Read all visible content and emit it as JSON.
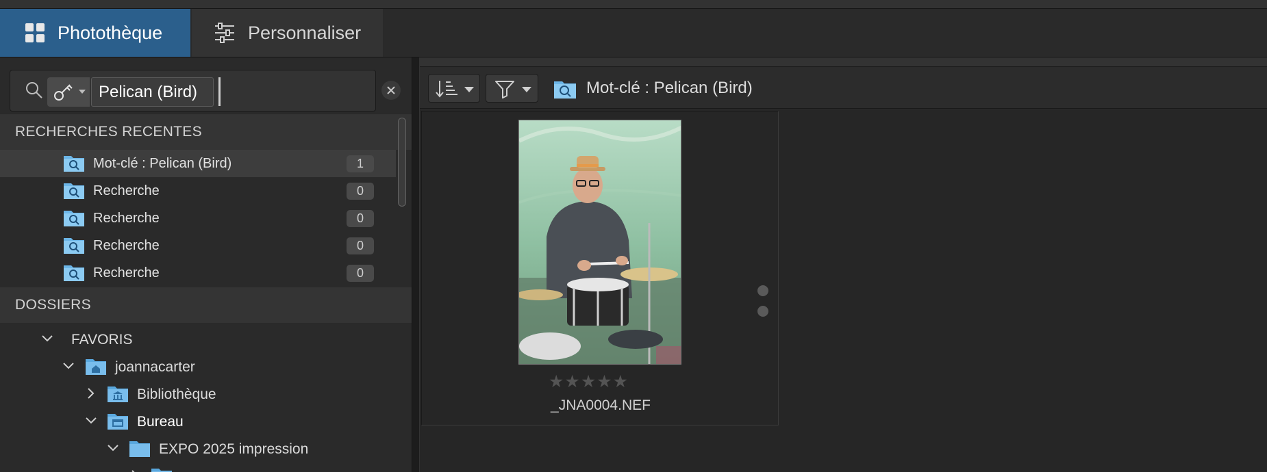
{
  "tabs": {
    "library": "Photothèque",
    "customize": "Personnaliser"
  },
  "search": {
    "token": "Pelican (Bird)",
    "type_icon": "key-icon"
  },
  "recent_searches": {
    "header": "RECHERCHES RECENTES",
    "items": [
      {
        "label": "Mot-clé : Pelican (Bird)",
        "count": "1",
        "selected": true
      },
      {
        "label": "Recherche",
        "count": "0"
      },
      {
        "label": "Recherche",
        "count": "0"
      },
      {
        "label": "Recherche",
        "count": "0"
      },
      {
        "label": "Recherche",
        "count": "0"
      }
    ]
  },
  "folders": {
    "header": "DOSSIERS",
    "favorites": "FAVORIS",
    "user": "joannacarter",
    "library": "Bibliothèque",
    "desktop": "Bureau",
    "expo": "EXPO 2025 impression"
  },
  "breadcrumb": {
    "text": "Mot-clé : Pelican (Bird)"
  },
  "thumbnail": {
    "filename": "_JNA0004.NEF",
    "stars": "★★★★★",
    "rating": 0
  },
  "colors": {
    "accent": "#2b5f8c",
    "folder": "#6cb6e8"
  }
}
